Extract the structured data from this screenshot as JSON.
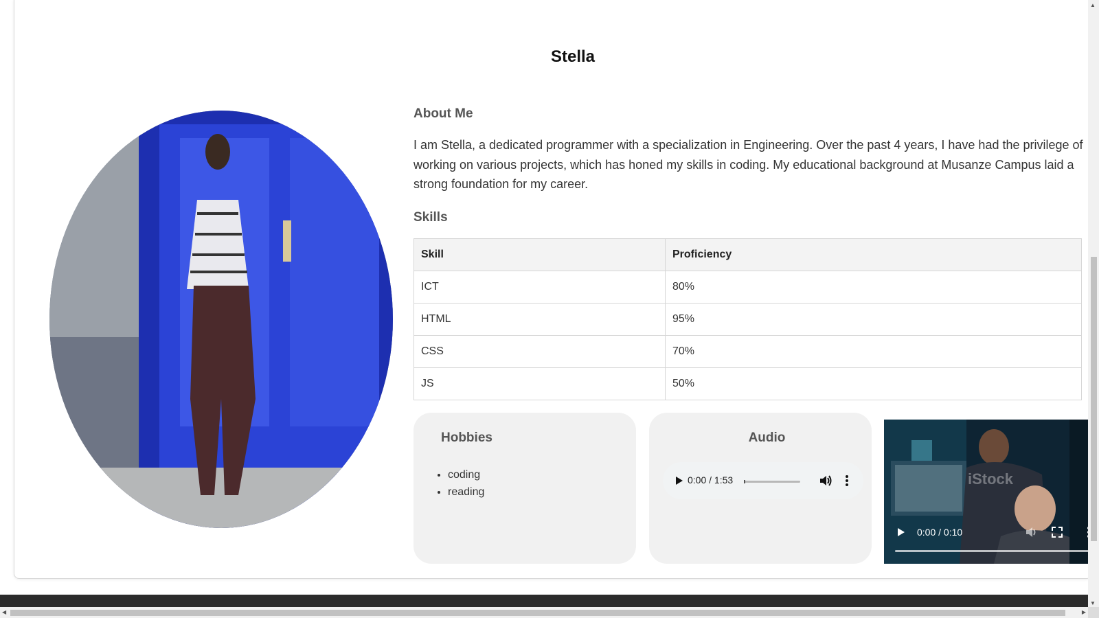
{
  "profile": {
    "name": "Stella"
  },
  "about": {
    "heading": "About Me",
    "text": "I am Stella, a dedicated programmer with a specialization in Engineering. Over the past 4 years, I have had the privilege of working on various projects, which has honed my skills in coding. My educational background at Musanze Campus laid a strong foundation for my career."
  },
  "skills": {
    "heading": "Skills",
    "columns": [
      "Skill",
      "Proficiency"
    ],
    "rows": [
      {
        "skill": "ICT",
        "proficiency": "80%"
      },
      {
        "skill": "HTML",
        "proficiency": "95%"
      },
      {
        "skill": "CSS",
        "proficiency": "70%"
      },
      {
        "skill": "JS",
        "proficiency": "50%"
      }
    ]
  },
  "hobbies": {
    "heading": "Hobbies",
    "items": [
      "coding",
      "reading"
    ]
  },
  "audio": {
    "heading": "Audio",
    "time": "0:00 / 1:53",
    "progress": 0
  },
  "video": {
    "time": "0:00 / 0:10",
    "watermark": "iStock",
    "progress": 0
  },
  "icons": {
    "play": "play-icon",
    "volume": "volume-icon",
    "more": "more-vertical-icon",
    "fullscreen": "fullscreen-icon"
  },
  "colors": {
    "footer": "#2b2b2b",
    "panel": "#f1f1f1",
    "heading": "#555555"
  }
}
